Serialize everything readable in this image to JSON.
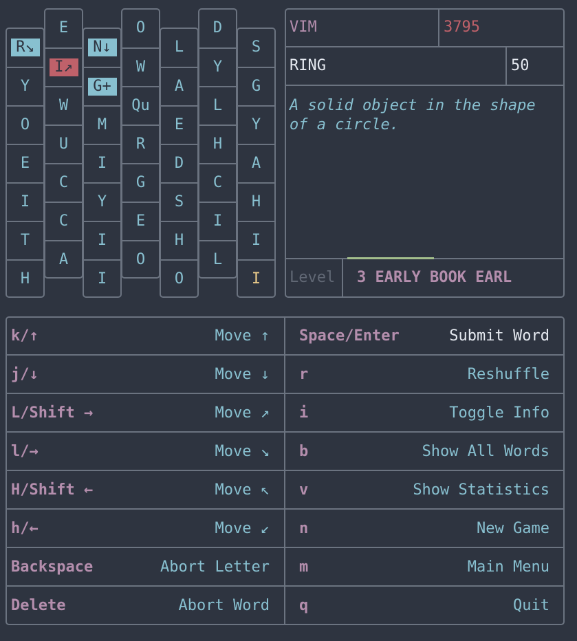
{
  "board": {
    "columns": [
      [
        "R↘",
        "Y",
        "O",
        "E",
        "I",
        "T",
        "H"
      ],
      [
        "E",
        "I↗",
        "W",
        "U",
        "C",
        "C",
        "A"
      ],
      [
        "N↓",
        "G+",
        "M",
        "I",
        "Y",
        "I",
        "I"
      ],
      [
        "O",
        "W",
        "Qu",
        "R",
        "G",
        "E",
        "O"
      ],
      [
        "L",
        "A",
        "E",
        "D",
        "S",
        "H",
        "O"
      ],
      [
        "D",
        "Y",
        "L",
        "H",
        "C",
        "I",
        "L"
      ],
      [
        "S",
        "G",
        "Y",
        "A",
        "H",
        "I",
        "I"
      ]
    ]
  },
  "info": {
    "mode_label": "VIM",
    "score": "3795",
    "word": "RING",
    "word_points": "50",
    "definition": "A solid object in the shape of a circle.",
    "level_label": "Level",
    "level_value": "3 EARLY BOOK EARL",
    "level_progress": 0.4
  },
  "keybindings": {
    "left": [
      {
        "key": "k/↑",
        "action": "Move ↑"
      },
      {
        "key": "j/↓",
        "action": "Move ↓"
      },
      {
        "key": "L/Shift →",
        "action": "Move ↗"
      },
      {
        "key": "l/→",
        "action": "Move ↘"
      },
      {
        "key": "H/Shift ←",
        "action": "Move ↖"
      },
      {
        "key": "h/←",
        "action": "Move ↙"
      },
      {
        "key": "Backspace",
        "action": "Abort Letter"
      },
      {
        "key": "Delete",
        "action": "Abort Word"
      }
    ],
    "right": [
      {
        "key": "Space/Enter",
        "action": "Submit Word"
      },
      {
        "key": "r",
        "action": "Reshuffle"
      },
      {
        "key": "i",
        "action": "Toggle Info"
      },
      {
        "key": "b",
        "action": "Show All Words"
      },
      {
        "key": "v",
        "action": "Show Statistics"
      },
      {
        "key": "n",
        "action": "New Game"
      },
      {
        "key": "m",
        "action": "Main Menu"
      },
      {
        "key": "q",
        "action": "Quit"
      }
    ]
  },
  "colors": {
    "background": "#2e3440",
    "border": "#6b7380",
    "letter": "#88c0d0",
    "selected_bg": "#88c0d0",
    "current_bg": "#bf616a",
    "key": "#b48ead",
    "score": "#bf616a",
    "progress": "#a3be8c",
    "special_letter": "#ebcb8b"
  }
}
